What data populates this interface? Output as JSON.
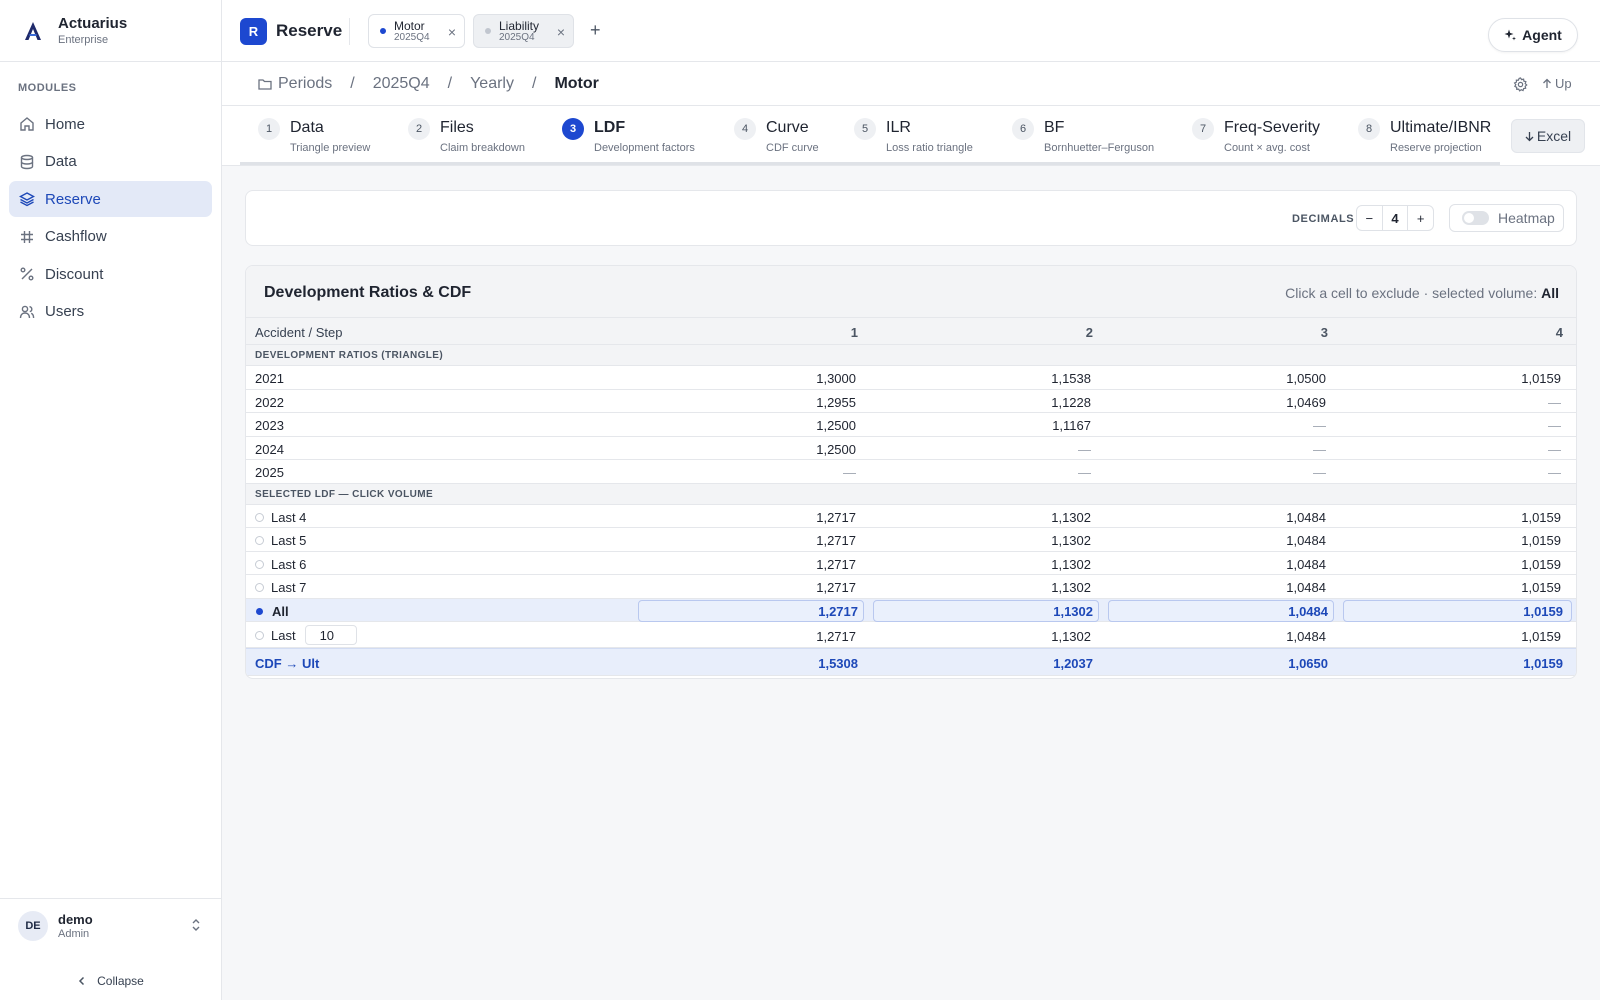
{
  "brand": {
    "name": "Actuarius",
    "edition": "Enterprise"
  },
  "sidebar": {
    "section_label": "MODULES",
    "items": [
      {
        "label": "Home",
        "icon": "home-icon"
      },
      {
        "label": "Data",
        "icon": "database-icon"
      },
      {
        "label": "Reserve",
        "icon": "layers-icon",
        "active": true
      },
      {
        "label": "Cashflow",
        "icon": "hash-icon"
      },
      {
        "label": "Discount",
        "icon": "percent-icon"
      },
      {
        "label": "Users",
        "icon": "users-icon"
      }
    ],
    "user": {
      "initials": "DE",
      "name": "demo",
      "role": "Admin"
    },
    "collapse_label": "Collapse"
  },
  "topbar": {
    "app_badge": "R",
    "app_title": "Reserve",
    "tabs": [
      {
        "name": "Motor",
        "period": "2025Q4",
        "dot_color": "#1d48d0"
      },
      {
        "name": "Liability",
        "period": "2025Q4",
        "dot_color": "#c1c6cf"
      }
    ],
    "add_tab": "+",
    "agent_label": "Agent"
  },
  "breadcrumb": {
    "items": [
      "Periods",
      "2025Q4",
      "Yearly",
      "Motor"
    ],
    "separator": "/",
    "up_label": "Up"
  },
  "steps": [
    {
      "num": "1",
      "label": "Data",
      "desc": "Triangle preview"
    },
    {
      "num": "2",
      "label": "Files",
      "desc": "Claim breakdown"
    },
    {
      "num": "3",
      "label": "LDF",
      "desc": "Development factors",
      "active": true
    },
    {
      "num": "4",
      "label": "Curve",
      "desc": "CDF curve"
    },
    {
      "num": "5",
      "label": "ILR",
      "desc": "Loss ratio triangle"
    },
    {
      "num": "6",
      "label": "BF",
      "desc": "Bornhuetter–Ferguson"
    },
    {
      "num": "7",
      "label": "Freq-Severity",
      "desc": "Count × avg. cost"
    },
    {
      "num": "8",
      "label": "Ultimate/IBNR",
      "desc": "Reserve projection"
    }
  ],
  "excel_label": "Excel",
  "controls": {
    "decimals_label": "DECIMALS",
    "minus": "−",
    "decimals_value": "4",
    "plus": "+",
    "heatmap_label": "Heatmap",
    "heatmap_on": false
  },
  "table": {
    "title": "Development Ratios & CDF",
    "hint_prefix": "Click a cell to exclude · selected volume:",
    "hint_value": "All",
    "header": {
      "label": "Accident / Step",
      "cols": [
        "1",
        "2",
        "3",
        "4"
      ]
    },
    "ratios_section": "DEVELOPMENT RATIOS (TRIANGLE)",
    "ratio_rows": [
      {
        "label": "2021",
        "values": [
          "1,3000",
          "1,1538",
          "1,0500",
          "1,0159"
        ]
      },
      {
        "label": "2022",
        "values": [
          "1,2955",
          "1,1228",
          "1,0469",
          "—"
        ]
      },
      {
        "label": "2023",
        "values": [
          "1,2500",
          "1,1167",
          "—",
          "—"
        ]
      },
      {
        "label": "2024",
        "values": [
          "1,2500",
          "—",
          "—",
          "—"
        ]
      },
      {
        "label": "2025",
        "values": [
          "—",
          "—",
          "—",
          "—"
        ]
      }
    ],
    "ldf_section": "SELECTED LDF — CLICK VOLUME",
    "ldf_rows": [
      {
        "label": "Last 4",
        "values": [
          "1,2717",
          "1,1302",
          "1,0484",
          "1,0159"
        ]
      },
      {
        "label": "Last 5",
        "values": [
          "1,2717",
          "1,1302",
          "1,0484",
          "1,0159"
        ]
      },
      {
        "label": "Last 6",
        "values": [
          "1,2717",
          "1,1302",
          "1,0484",
          "1,0159"
        ]
      },
      {
        "label": "Last 7",
        "values": [
          "1,2717",
          "1,1302",
          "1,0484",
          "1,0159"
        ]
      },
      {
        "label": "All",
        "values": [
          "1,2717",
          "1,1302",
          "1,0484",
          "1,0159"
        ],
        "selected": true
      }
    ],
    "last_n": {
      "label": "Last",
      "value": "10",
      "values": [
        "1,2717",
        "1,1302",
        "1,0484",
        "1,0159"
      ]
    },
    "cdf_row": {
      "label": "CDF → Ult",
      "values": [
        "1,5308",
        "1,2037",
        "1,0650",
        "1,0159"
      ]
    }
  }
}
